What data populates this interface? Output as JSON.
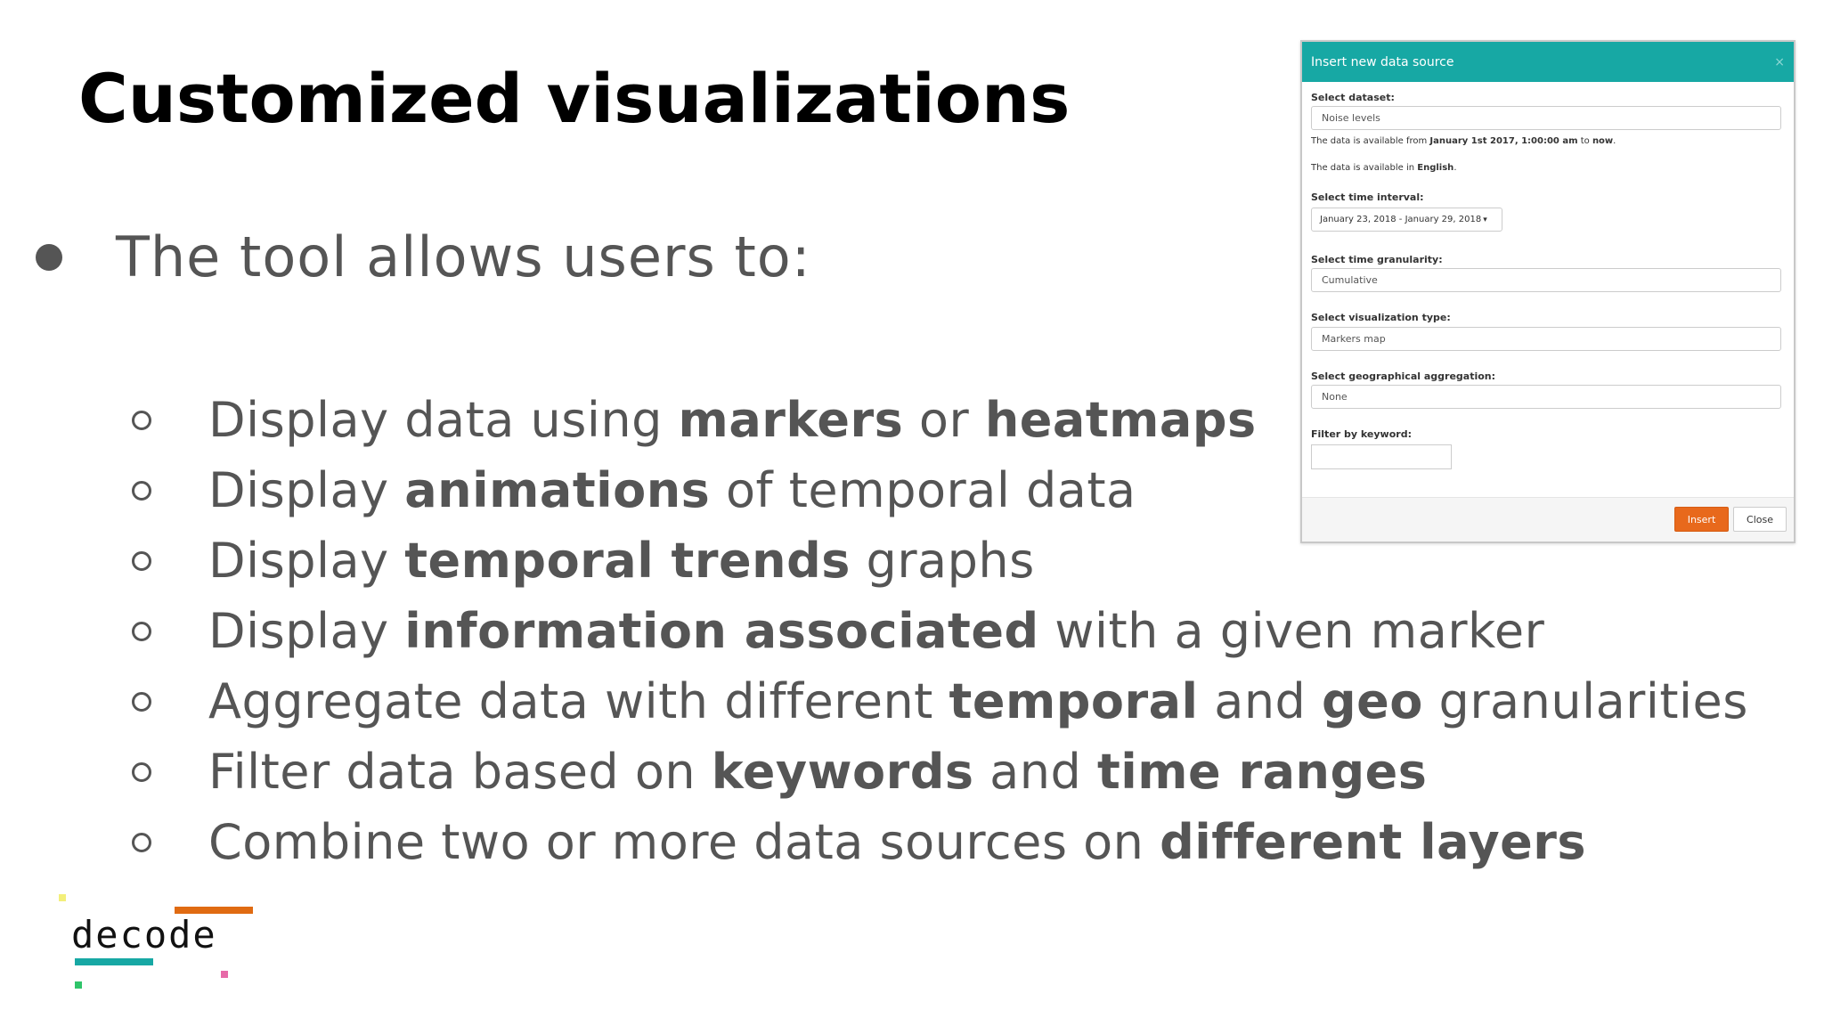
{
  "slide": {
    "title": "Customized visualizations",
    "main_bullet": "The tool allows users to:",
    "sub_bullets": [
      [
        {
          "t": "Display data using ",
          "b": false
        },
        {
          "t": "markers",
          "b": true
        },
        {
          "t": " or ",
          "b": false
        },
        {
          "t": "heatmaps",
          "b": true
        }
      ],
      [
        {
          "t": "Display ",
          "b": false
        },
        {
          "t": "animations",
          "b": true
        },
        {
          "t": " of temporal data",
          "b": false
        }
      ],
      [
        {
          "t": "Display ",
          "b": false
        },
        {
          "t": "temporal trends",
          "b": true
        },
        {
          "t": " graphs",
          "b": false
        }
      ],
      [
        {
          "t": "Display ",
          "b": false
        },
        {
          "t": "information associated",
          "b": true
        },
        {
          "t": " with a given marker",
          "b": false
        }
      ],
      [
        {
          "t": "Aggregate data with different  ",
          "b": false
        },
        {
          "t": "temporal",
          "b": true
        },
        {
          "t": " and ",
          "b": false
        },
        {
          "t": "geo",
          "b": true
        },
        {
          "t": " granularities",
          "b": false
        }
      ],
      [
        {
          "t": "Filter data based on ",
          "b": false
        },
        {
          "t": "keywords",
          "b": true
        },
        {
          "t": " and ",
          "b": false
        },
        {
          "t": "time ranges",
          "b": true
        }
      ],
      [
        {
          "t": "Combine two or more data sources on ",
          "b": false
        },
        {
          "t": "different layers",
          "b": true
        }
      ]
    ]
  },
  "dialog": {
    "title": "Insert new data source",
    "close_symbol": "×",
    "dataset_label": "Select dataset:",
    "dataset_value": "Noise levels",
    "availability_prefix": "The data is available from ",
    "availability_from": "January 1st 2017, 1:00:00 am",
    "availability_mid": " to ",
    "availability_to": "now",
    "availability_end": ".",
    "language_prefix": "The data is available in ",
    "language_value": "English",
    "language_end": ".",
    "interval_label": "Select time interval:",
    "interval_value": "January 23, 2018 - January 29, 2018",
    "interval_caret": "▾",
    "granularity_label": "Select time granularity:",
    "granularity_value": "Cumulative",
    "vis_type_label": "Select visualization type:",
    "vis_type_value": "Markers map",
    "geo_label": "Select geographical aggregation:",
    "geo_value": "None",
    "keyword_label": "Filter by keyword:",
    "keyword_value": "",
    "insert_button": "Insert",
    "close_button": "Close"
  },
  "logo": {
    "text": "decode",
    "colors": {
      "teal": "#17a8a4",
      "orange": "#e06b12",
      "yellow": "#f3ef7a",
      "green": "#2fc46a",
      "pink": "#e76aa8"
    }
  },
  "colors": {
    "text_gray": "#555555",
    "title_black": "#000000",
    "dialog_header": "#17a8a4",
    "insert_button": "#e8691c"
  }
}
